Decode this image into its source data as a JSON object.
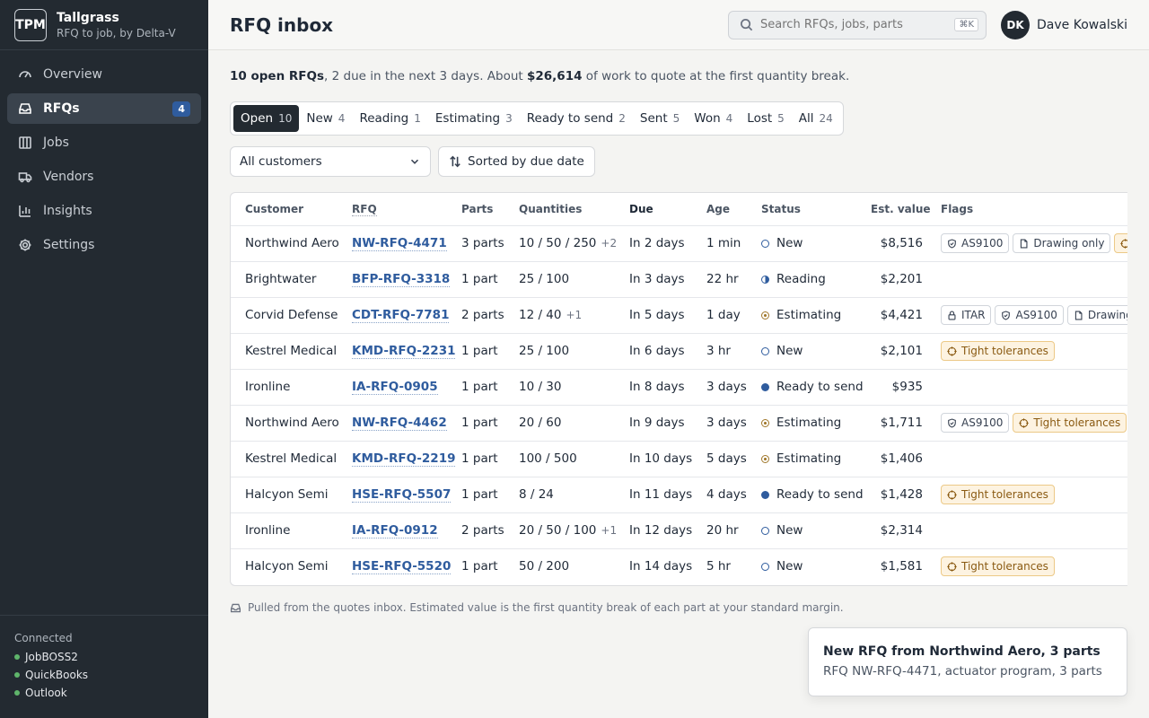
{
  "brand": {
    "logo": "TPM",
    "name": "Tallgrass",
    "subtitle": "RFQ to job, by Delta-V"
  },
  "nav": [
    {
      "label": "Overview",
      "icon": "gauge-icon",
      "active": false
    },
    {
      "label": "RFQs",
      "icon": "inbox-icon",
      "active": true,
      "badge": "4"
    },
    {
      "label": "Jobs",
      "icon": "columns-icon",
      "active": false
    },
    {
      "label": "Vendors",
      "icon": "truck-icon",
      "active": false
    },
    {
      "label": "Insights",
      "icon": "bar-chart-icon",
      "active": false
    },
    {
      "label": "Settings",
      "icon": "gear-icon",
      "active": false
    }
  ],
  "connected": {
    "title": "Connected",
    "items": [
      "JobBOSS2",
      "QuickBooks",
      "Outlook"
    ]
  },
  "header": {
    "title": "RFQ inbox",
    "search_placeholder": "Search RFQs, jobs, parts",
    "search_shortcut": "⌘K",
    "user_initials": "DK",
    "user_name": "Dave Kowalski"
  },
  "summary": {
    "open": "10 open RFQs",
    "mid": ", 2 due in the next 3 days. About ",
    "value": "$26,614",
    "tail": " of work to quote at the first quantity break."
  },
  "tabs": [
    {
      "label": "Open",
      "count": "10",
      "active": true
    },
    {
      "label": "New",
      "count": "4"
    },
    {
      "label": "Reading",
      "count": "1"
    },
    {
      "label": "Estimating",
      "count": "3"
    },
    {
      "label": "Ready to send",
      "count": "2"
    },
    {
      "label": "Sent",
      "count": "5"
    },
    {
      "label": "Won",
      "count": "4"
    },
    {
      "label": "Lost",
      "count": "5"
    },
    {
      "label": "All",
      "count": "24"
    }
  ],
  "filters": {
    "customer": "All customers",
    "sort": "Sorted by due date"
  },
  "columns": {
    "customer": "Customer",
    "rfq": "RFQ",
    "parts": "Parts",
    "quantities": "Quantities",
    "due": "Due",
    "age": "Age",
    "status": "Status",
    "value": "Est. value",
    "flags": "Flags"
  },
  "rows": [
    {
      "customer": "Northwind Aero",
      "rfq": "NW-RFQ-4471",
      "parts": "3 parts",
      "qty": "10 / 50 / 250",
      "qty_more": "+2",
      "due": "In 2 days",
      "age": "1 min",
      "status": "New",
      "status_kind": "new",
      "value": "$8,516",
      "flags": [
        {
          "label": "AS9100",
          "icon": "shield-icon",
          "kind": "plain"
        },
        {
          "label": "Drawing only",
          "icon": "file-icon",
          "kind": "plain"
        },
        {
          "label": "Tight tolerances",
          "icon": "target-icon",
          "kind": "tight"
        }
      ]
    },
    {
      "customer": "Brightwater",
      "rfq": "BFP-RFQ-3318",
      "parts": "1 part",
      "qty": "25 / 100",
      "qty_more": "",
      "due": "In 3 days",
      "age": "22 hr",
      "status": "Reading",
      "status_kind": "reading",
      "value": "$2,201",
      "flags": []
    },
    {
      "customer": "Corvid Defense",
      "rfq": "CDT-RFQ-7781",
      "parts": "2 parts",
      "qty": "12 / 40",
      "qty_more": "+1",
      "due": "In 5 days",
      "age": "1 day",
      "status": "Estimating",
      "status_kind": "estimating",
      "value": "$4,421",
      "flags": [
        {
          "label": "ITAR",
          "icon": "lock-icon",
          "kind": "plain"
        },
        {
          "label": "AS9100",
          "icon": "shield-icon",
          "kind": "plain"
        },
        {
          "label": "Drawing only",
          "icon": "file-icon",
          "kind": "plain"
        }
      ]
    },
    {
      "customer": "Kestrel Medical",
      "rfq": "KMD-RFQ-2231",
      "parts": "1 part",
      "qty": "25 / 100",
      "qty_more": "",
      "due": "In 6 days",
      "age": "3 hr",
      "status": "New",
      "status_kind": "new",
      "value": "$2,101",
      "flags": [
        {
          "label": "Tight tolerances",
          "icon": "target-icon",
          "kind": "tight"
        }
      ]
    },
    {
      "customer": "Ironline",
      "rfq": "IA-RFQ-0905",
      "parts": "1 part",
      "qty": "10 / 30",
      "qty_more": "",
      "due": "In 8 days",
      "age": "3 days",
      "status": "Ready to send",
      "status_kind": "ready",
      "value": "$935",
      "flags": []
    },
    {
      "customer": "Northwind Aero",
      "rfq": "NW-RFQ-4462",
      "parts": "1 part",
      "qty": "20 / 60",
      "qty_more": "",
      "due": "In 9 days",
      "age": "3 days",
      "status": "Estimating",
      "status_kind": "estimating",
      "value": "$1,711",
      "flags": [
        {
          "label": "AS9100",
          "icon": "shield-icon",
          "kind": "plain"
        },
        {
          "label": "Tight tolerances",
          "icon": "target-icon",
          "kind": "tight"
        }
      ]
    },
    {
      "customer": "Kestrel Medical",
      "rfq": "KMD-RFQ-2219",
      "parts": "1 part",
      "qty": "100 / 500",
      "qty_more": "",
      "due": "In 10 days",
      "age": "5 days",
      "status": "Estimating",
      "status_kind": "estimating",
      "value": "$1,406",
      "flags": []
    },
    {
      "customer": "Halcyon Semi",
      "rfq": "HSE-RFQ-5507",
      "parts": "1 part",
      "qty": "8 / 24",
      "qty_more": "",
      "due": "In 11 days",
      "age": "4 days",
      "status": "Ready to send",
      "status_kind": "ready",
      "value": "$1,428",
      "flags": [
        {
          "label": "Tight tolerances",
          "icon": "target-icon",
          "kind": "tight"
        }
      ]
    },
    {
      "customer": "Ironline",
      "rfq": "IA-RFQ-0912",
      "parts": "2 parts",
      "qty": "20 / 50 / 100",
      "qty_more": "+1",
      "due": "In 12 days",
      "age": "20 hr",
      "status": "New",
      "status_kind": "new",
      "value": "$2,314",
      "flags": []
    },
    {
      "customer": "Halcyon Semi",
      "rfq": "HSE-RFQ-5520",
      "parts": "1 part",
      "qty": "50 / 200",
      "qty_more": "",
      "due": "In 14 days",
      "age": "5 hr",
      "status": "New",
      "status_kind": "new",
      "value": "$1,581",
      "flags": [
        {
          "label": "Tight tolerances",
          "icon": "target-icon",
          "kind": "tight"
        }
      ]
    }
  ],
  "footnote": "Pulled from the quotes inbox. Estimated value is the first quantity break of each part at your standard margin.",
  "toast": {
    "title": "New RFQ from Northwind Aero, 3 parts",
    "body": "RFQ NW-RFQ-4471, actuator program, 3 parts"
  }
}
